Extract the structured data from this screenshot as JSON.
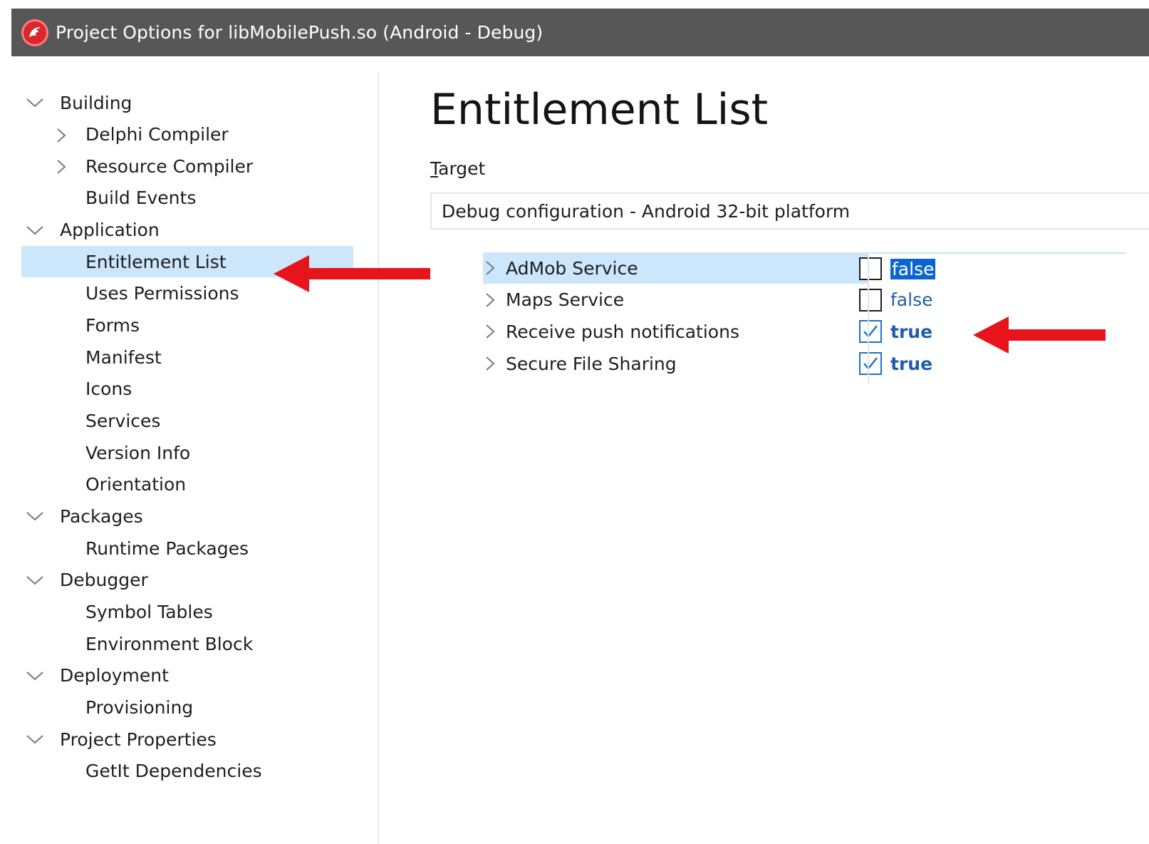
{
  "window": {
    "title": "Project Options for libMobilePush.so  (Android - Debug)",
    "icon": "app-logo-icon"
  },
  "tree": [
    {
      "label": "Building",
      "level": 0,
      "expander": "expanded"
    },
    {
      "label": "Delphi Compiler",
      "level": 1,
      "expander": "collapsed"
    },
    {
      "label": "Resource Compiler",
      "level": 1,
      "expander": "collapsed"
    },
    {
      "label": "Build Events",
      "level": 1,
      "expander": "none"
    },
    {
      "label": "Application",
      "level": 0,
      "expander": "expanded"
    },
    {
      "label": "Entitlement List",
      "level": 1,
      "expander": "none",
      "selected": true
    },
    {
      "label": "Uses Permissions",
      "level": 1,
      "expander": "none"
    },
    {
      "label": "Forms",
      "level": 1,
      "expander": "none"
    },
    {
      "label": "Manifest",
      "level": 1,
      "expander": "none"
    },
    {
      "label": "Icons",
      "level": 1,
      "expander": "none"
    },
    {
      "label": "Services",
      "level": 1,
      "expander": "none"
    },
    {
      "label": "Version Info",
      "level": 1,
      "expander": "none"
    },
    {
      "label": "Orientation",
      "level": 1,
      "expander": "none"
    },
    {
      "label": "Packages",
      "level": 0,
      "expander": "expanded"
    },
    {
      "label": "Runtime Packages",
      "level": 1,
      "expander": "none"
    },
    {
      "label": "Debugger",
      "level": 0,
      "expander": "expanded"
    },
    {
      "label": "Symbol Tables",
      "level": 1,
      "expander": "none"
    },
    {
      "label": "Environment Block",
      "level": 1,
      "expander": "none"
    },
    {
      "label": "Deployment",
      "level": 0,
      "expander": "expanded"
    },
    {
      "label": "Provisioning",
      "level": 1,
      "expander": "none"
    },
    {
      "label": "Project Properties",
      "level": 0,
      "expander": "expanded"
    },
    {
      "label": "GetIt Dependencies",
      "level": 1,
      "expander": "none"
    }
  ],
  "content": {
    "title": "Entitlement List",
    "target_label_mnemonic": "T",
    "target_label_rest": "arget",
    "target_value": "Debug configuration - Android 32-bit platform"
  },
  "properties": [
    {
      "name": "AdMob Service",
      "checked": false,
      "value": "false",
      "selected": true
    },
    {
      "name": "Maps Service",
      "checked": false,
      "value": "false",
      "selected": false
    },
    {
      "name": "Receive push notifications",
      "checked": true,
      "value": "true",
      "selected": false
    },
    {
      "name": "Secure File Sharing",
      "checked": true,
      "value": "true",
      "selected": false
    }
  ],
  "colors": {
    "titlebar": "#575757",
    "selection": "#cce6fb",
    "annotation_arrow": "#e8141b",
    "value_text": "#1f5fa8",
    "checkbox_check": "#1a73c6"
  }
}
